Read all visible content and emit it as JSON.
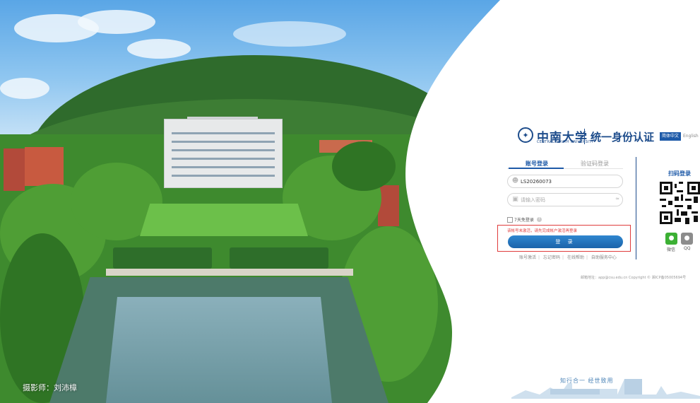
{
  "photo": {
    "credit": "摄影师：刘沛樟"
  },
  "header": {
    "logo_icon": "university-seal-icon",
    "school_name": "中南大学",
    "school_name_en": "CENTRAL SOUTH UNIVERSITY",
    "auth_title": "统一身份认证",
    "lang_zh": "简体中文",
    "lang_en": "English"
  },
  "login": {
    "tabs": [
      {
        "label": "账号登录"
      },
      {
        "label": "验证码登录"
      }
    ],
    "username": {
      "value": "LS20260073",
      "icon": "user-icon"
    },
    "password": {
      "placeholder": "请输入密码",
      "icon": "lock-icon"
    },
    "remember_label": "7天免登录",
    "error_message": "该帐号未激活，请先完成帐户激活再登录",
    "submit_label": "登 录",
    "links": [
      "账号激活",
      "忘记密码",
      "在线帮助",
      "自助服务中心"
    ]
  },
  "qr_login": {
    "title": "扫码登录",
    "apps": [
      {
        "label": "微信",
        "icon": "wechat-icon"
      },
      {
        "label": "QQ",
        "icon": "qq-icon"
      }
    ]
  },
  "footer": {
    "note": "邮箱地址：app@csu.edu.cn Copyright © 湘ICP备05005694号",
    "slogan": "知行合一  经世致用"
  },
  "colors": {
    "brand": "#1e4d8c",
    "accent": "#1e5aa8",
    "error": "#e03c3c"
  }
}
